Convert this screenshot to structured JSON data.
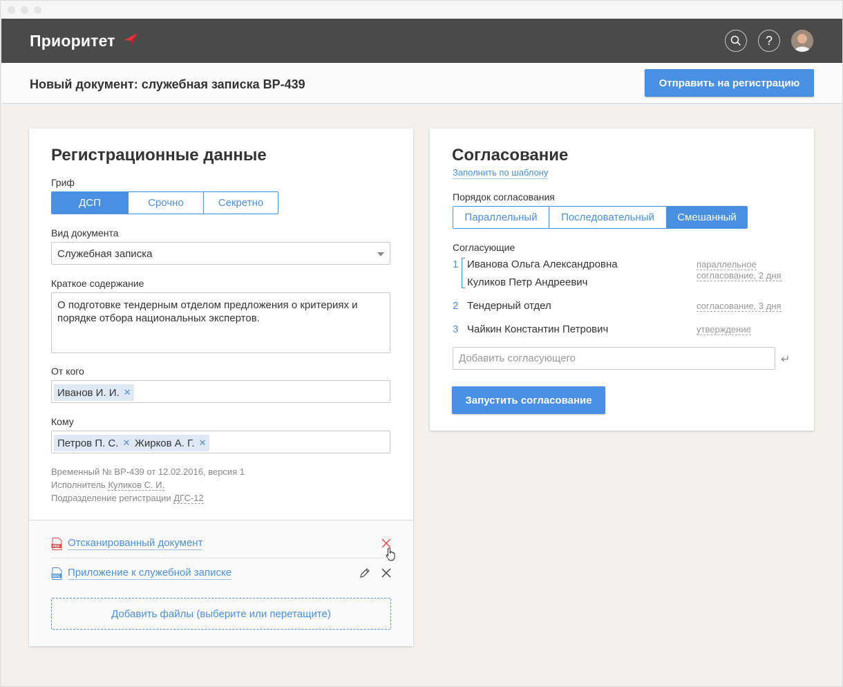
{
  "app": {
    "logo_text": "Приоритет",
    "colors": {
      "accent": "#4a90e2",
      "topbar": "#4a4a4a",
      "logo_mark": "#e2373f",
      "remove_red": "#e24a4a"
    }
  },
  "topbar": {
    "search_icon": "search-icon",
    "help_label": "?",
    "avatar_icon": "user-avatar"
  },
  "docbar": {
    "title": "Новый документ: служебная записка ВР-439",
    "send_button": "Отправить на регистрацию"
  },
  "registration": {
    "title": "Регистрационные данные",
    "grif_label": "Гриф",
    "grif_options": [
      "ДСП",
      "Срочно",
      "Секретно"
    ],
    "grif_selected": "ДСП",
    "doc_type_label": "Вид документа",
    "doc_type_value": "Служебная записка",
    "summary_label": "Краткое содержание",
    "summary_value": "О подготовке тендерным отделом предложения о критериях и порядке отбора национальных экспертов.",
    "from_label": "От кого",
    "from_chips": [
      "Иванов И. И."
    ],
    "to_label": "Кому",
    "to_chips": [
      "Петров П. С.",
      "Жирков А. Г."
    ],
    "meta_line1": "Временный № ВР-439 от 12.02.2016, версия 1",
    "executor_prefix": "Исполнитель",
    "executor_value": "Куликов С. И.",
    "department_prefix": "Подразделение регистрации",
    "department_value": "ДГС-12",
    "files": [
      {
        "name": "Отсканированный документ",
        "type": "PDF",
        "icon": "pdf-file-icon"
      },
      {
        "name": "Приложение к служебной записке",
        "type": "DOC",
        "icon": "doc-file-icon"
      }
    ],
    "dropzone_label": "Добавить файлы (выберите или перетащите)"
  },
  "approval": {
    "title": "Согласование",
    "template_link": "Заполнить по шаблону",
    "order_label": "Порядок согласования",
    "order_options": [
      "Параллельный",
      "Последовательный",
      "Смешанный"
    ],
    "order_selected": "Смешанный",
    "approvers_label": "Согласующие",
    "groups": [
      {
        "num": "1",
        "names": [
          "Иванова Ольга Александровна",
          "Куликов Петр Андреевич"
        ],
        "note_line1": "параллельное",
        "note_line2": "согласование, 2 дня"
      },
      {
        "num": "2",
        "names": [
          "Тендерный отдел"
        ],
        "note_line1": "согласование, 3 дня"
      },
      {
        "num": "3",
        "names": [
          "Чайкин Константин Петрович"
        ],
        "note_line1": "утверждение"
      }
    ],
    "add_placeholder": "Добавить согласующего",
    "start_button": "Запустить согласование"
  }
}
